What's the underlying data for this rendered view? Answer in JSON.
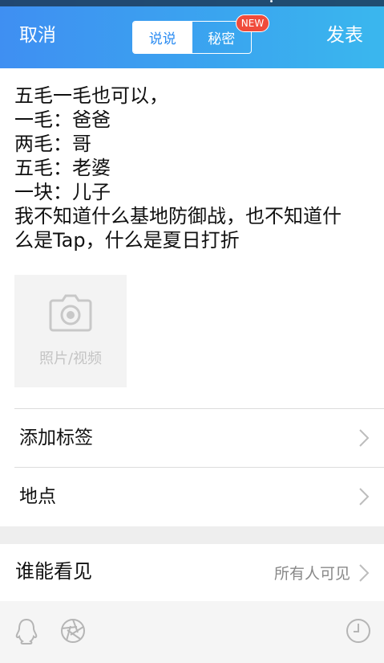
{
  "header": {
    "cancel_label": "取消",
    "post_label": "发表",
    "tabs": [
      {
        "label": "说说",
        "active": true
      },
      {
        "label": "秘密",
        "active": false
      }
    ],
    "new_badge": "NEW",
    "accent_color": "#3a9bf0"
  },
  "post": {
    "text": "五毛一毛也可以，\n一毛：爸爸\n两毛：哥\n五毛：老婆\n一块：儿子\n我不知道什么基地防御战，也不知道什\n么是Tap，什么是夏日打折"
  },
  "media": {
    "label": "照片/视频",
    "icon": "camera-icon"
  },
  "options": {
    "add_tag": "添加标签",
    "location": "地点"
  },
  "visibility": {
    "label": "谁能看见",
    "value": "所有人可见"
  },
  "toolbar": {
    "icons": [
      "qq-penguin-icon",
      "aperture-icon",
      "clock-icon"
    ]
  }
}
